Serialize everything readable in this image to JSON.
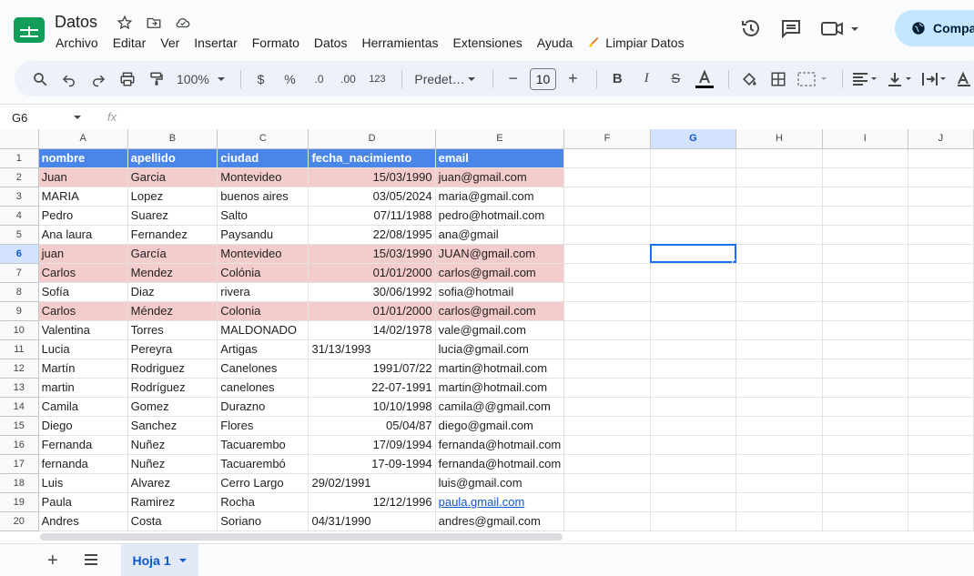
{
  "app": {
    "title": "Datos",
    "share_label": "Compa"
  },
  "menu": [
    "Archivo",
    "Editar",
    "Ver",
    "Insertar",
    "Formato",
    "Datos",
    "Herramientas",
    "Extensiones",
    "Ayuda"
  ],
  "menu_special": "Limpiar Datos",
  "toolbar": {
    "zoom": "100%",
    "currency": "$",
    "percent": "%",
    "dec_decrease": ".0",
    "dec_increase": ".00",
    "number_format": "123",
    "font": "Predet…",
    "font_size": "10"
  },
  "namebox": "G6",
  "fx": "fx",
  "columns": [
    "A",
    "B",
    "C",
    "D",
    "E",
    "F",
    "G",
    "H",
    "I",
    "J"
  ],
  "selected_column": "G",
  "selected_row": "6",
  "rows": [
    {
      "n": "1",
      "cells": [
        "nombre",
        "apellido",
        "ciudad",
        "fecha_nacimiento",
        "email"
      ],
      "style": "hdr"
    },
    {
      "n": "2",
      "cells": [
        "Juan",
        "Garcia",
        "Montevideo",
        "15/03/1990",
        "juan@gmail.com"
      ],
      "style": "pink",
      "date_align": "right"
    },
    {
      "n": "3",
      "cells": [
        "MARIA",
        "Lopez",
        "buenos aires",
        "03/05/2024",
        "maria@gmail.com"
      ],
      "style": "",
      "date_align": "right"
    },
    {
      "n": "4",
      "cells": [
        "Pedro",
        "Suarez",
        "Salto",
        "07/11/1988",
        "pedro@hotmail.com"
      ],
      "style": "",
      "date_align": "right"
    },
    {
      "n": "5",
      "cells": [
        "Ana laura",
        "Fernandez",
        "Paysandu",
        "22/08/1995",
        "ana@gmail"
      ],
      "style": "",
      "date_align": "right"
    },
    {
      "n": "6",
      "cells": [
        "juan",
        "García",
        "Montevideo",
        "15/03/1990",
        "JUAN@gmail.com"
      ],
      "style": "pink",
      "date_align": "right"
    },
    {
      "n": "7",
      "cells": [
        "Carlos",
        "Mendez",
        "Colónia",
        "01/01/2000",
        "carlos@gmail.com"
      ],
      "style": "pink",
      "date_align": "right"
    },
    {
      "n": "8",
      "cells": [
        "Sofía",
        "Diaz",
        "rivera",
        "30/06/1992",
        "sofia@hotmail"
      ],
      "style": "",
      "date_align": "right"
    },
    {
      "n": "9",
      "cells": [
        "Carlos",
        "Méndez",
        "Colonia",
        "01/01/2000",
        "carlos@gmail.com"
      ],
      "style": "pink",
      "date_align": "right"
    },
    {
      "n": "10",
      "cells": [
        "Valentina",
        "Torres",
        "MALDONADO",
        "14/02/1978",
        "vale@gmail.com"
      ],
      "style": "",
      "date_align": "right"
    },
    {
      "n": "11",
      "cells": [
        "Lucia",
        "Pereyra",
        "Artigas",
        "31/13/1993",
        "lucia@gmail.com"
      ],
      "style": "",
      "date_align": "left"
    },
    {
      "n": "12",
      "cells": [
        "Martín",
        "Rodriguez",
        "Canelones",
        "1991/07/22",
        "martin@hotmail.com"
      ],
      "style": "",
      "date_align": "right"
    },
    {
      "n": "13",
      "cells": [
        "martin",
        "Rodríguez",
        "canelones",
        "22-07-1991",
        "martin@hotmail.com"
      ],
      "style": "",
      "date_align": "right"
    },
    {
      "n": "14",
      "cells": [
        "Camila",
        "Gomez",
        "Durazno",
        "10/10/1998",
        "camila@@gmail.com"
      ],
      "style": "",
      "date_align": "right"
    },
    {
      "n": "15",
      "cells": [
        "Diego",
        "Sanchez",
        "Flores",
        "05/04/87",
        "diego@gmail.com"
      ],
      "style": "",
      "date_align": "right"
    },
    {
      "n": "16",
      "cells": [
        "Fernanda",
        "Nuñez",
        "Tacuarembo",
        "17/09/1994",
        "fernanda@hotmail.com"
      ],
      "style": "",
      "date_align": "right"
    },
    {
      "n": "17",
      "cells": [
        "fernanda",
        "Nuñez",
        "Tacuarembó",
        "17-09-1994",
        "fernanda@hotmail.com"
      ],
      "style": "",
      "date_align": "right"
    },
    {
      "n": "18",
      "cells": [
        "Luis",
        "Alvarez",
        "Cerro Largo",
        "29/02/1991",
        "luis@gmail.com"
      ],
      "style": "",
      "date_align": "left"
    },
    {
      "n": "19",
      "cells": [
        "Paula",
        "Ramirez",
        "Rocha",
        "12/12/1996",
        "paula.gmail.com"
      ],
      "style": "",
      "date_align": "right",
      "email_link": true
    },
    {
      "n": "20",
      "cells": [
        "Andres",
        "Costa",
        "Soriano",
        "04/31/1990",
        "andres@gmail.com"
      ],
      "style": "",
      "date_align": "left"
    }
  ],
  "sheet_tab": "Hoja 1",
  "colors": {
    "header_fill": "#4a86e8",
    "duplicate_fill": "#f4cccc",
    "accent": "#1a73e8"
  }
}
